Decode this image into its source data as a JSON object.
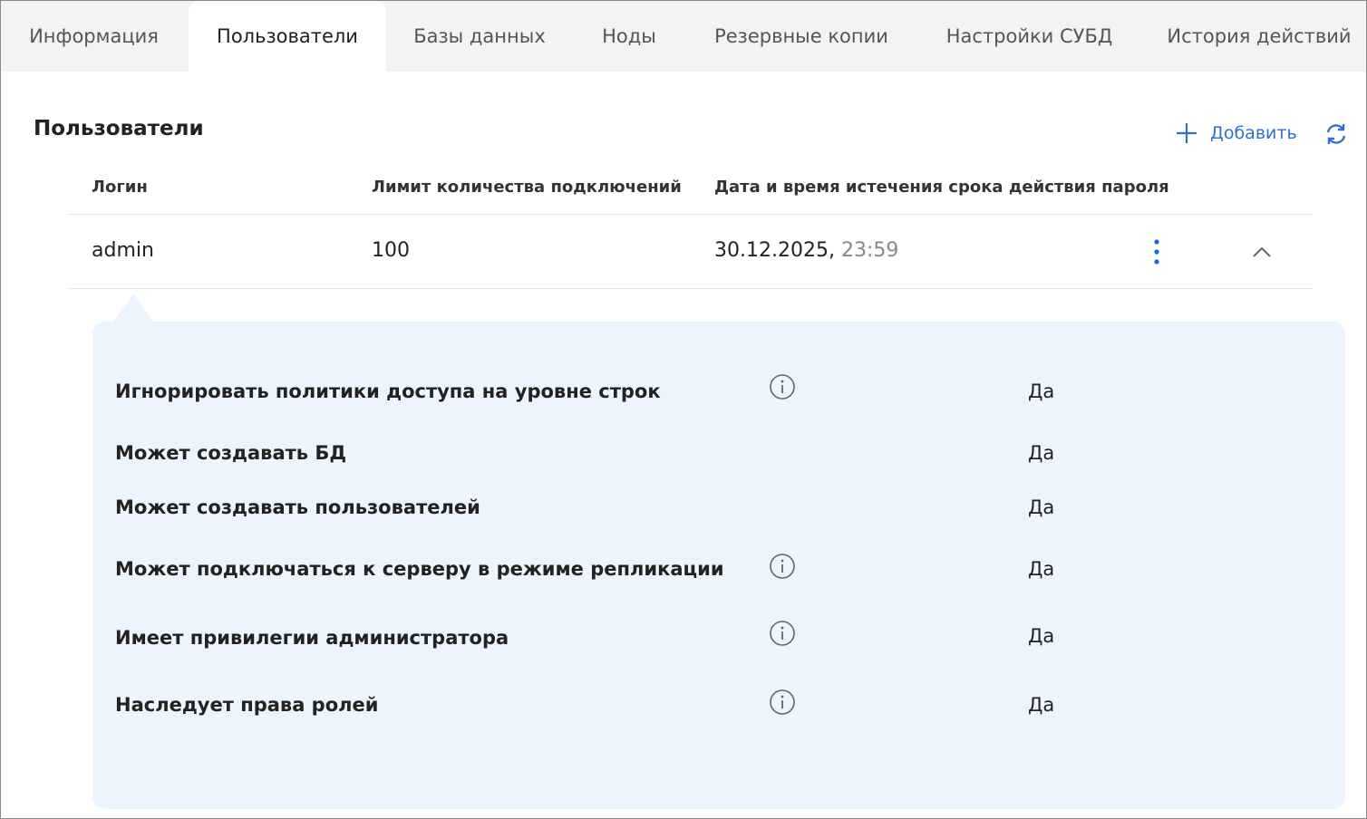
{
  "tabs": [
    "Информация",
    "Пользователи",
    "Базы данных",
    "Ноды",
    "Резервные копии",
    "Настройки СУБД",
    "История действий"
  ],
  "section": {
    "title": "Пользователи",
    "add_label": "Добавить"
  },
  "table": {
    "headers": [
      "Логин",
      "Лимит количества подключений",
      "Дата и время истечения срока действия пароля"
    ],
    "row": {
      "login": "admin",
      "limit": "100",
      "date": "30.12.2025,",
      "time": "23:59"
    }
  },
  "details": {
    "items": [
      {
        "label": "Игнорировать политики доступа на уровне строк",
        "value": "Да"
      },
      {
        "label": "Может создавать БД",
        "value": "Да"
      },
      {
        "label": "Может создавать пользователей",
        "value": "Да"
      },
      {
        "label": "Может подключаться к серверу в режиме репликации",
        "value": "Да"
      },
      {
        "label": "Имеет привилегии администратора",
        "value": "Да"
      },
      {
        "label": "Наследует права ролей",
        "value": "Да"
      }
    ]
  },
  "colors": {
    "accent": "#2f6fd8",
    "kebab": "#1a66e0",
    "details_bg": "#ecf4fd",
    "tabbar_bg": "#f3f3f3"
  },
  "icons": {
    "add": "plus-icon",
    "refresh": "refresh-icon",
    "menu": "kebab-icon",
    "collapse": "chevron-up-icon",
    "info": "info-icon"
  }
}
